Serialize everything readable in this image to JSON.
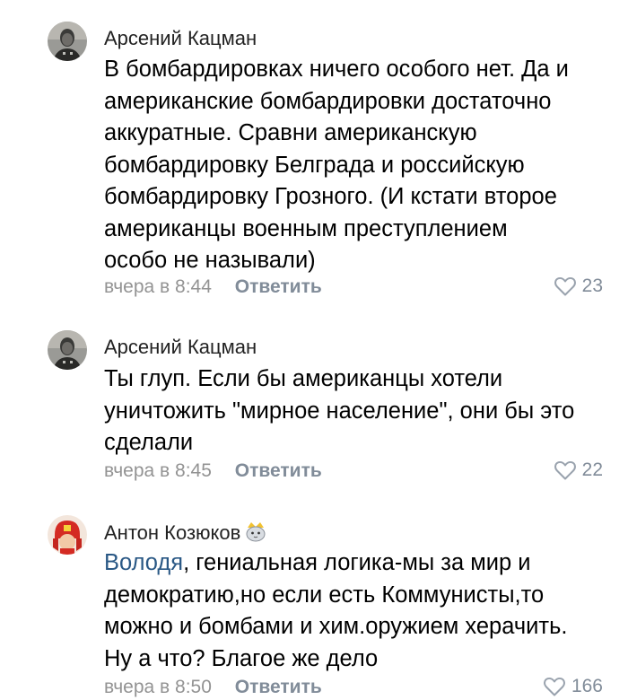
{
  "comments": [
    {
      "author": "Арсений Кацман",
      "lines": [
        "В бомбардировках ничего особого нет. Да и",
        "американские бомбардировки достаточно",
        "аккуратные. Сравни американскую",
        "бомбардировку Белграда и российскую",
        "бомбардировку Грозного. (И кстати второе",
        "американцы военным преступлением",
        "особо не называли)"
      ],
      "time": "вчера в 8:44",
      "reply_label": "Ответить",
      "likes": "23"
    },
    {
      "author": "Арсений Кацман",
      "lines": [
        "Ты глуп. Если бы американцы хотели",
        "уничтожить \"мирное население\", они бы это",
        "сделали"
      ],
      "time": "вчера в 8:45",
      "reply_label": "Ответить",
      "likes": "22"
    },
    {
      "author": "Антон Козюков",
      "mention": "Володя",
      "first_line_rest": ", гениальная логика-мы за мир и",
      "lines": [
        "демократию,но если есть Коммунисты,то",
        "можно и бомбами и хим.оружием херачить.",
        "Ну а что? Благое же дело"
      ],
      "time": "вчера в 8:50",
      "reply_label": "Ответить",
      "likes": "166"
    }
  ],
  "colors": {
    "link": "#2a5885",
    "meta": "#939393",
    "action": "#818c99"
  }
}
